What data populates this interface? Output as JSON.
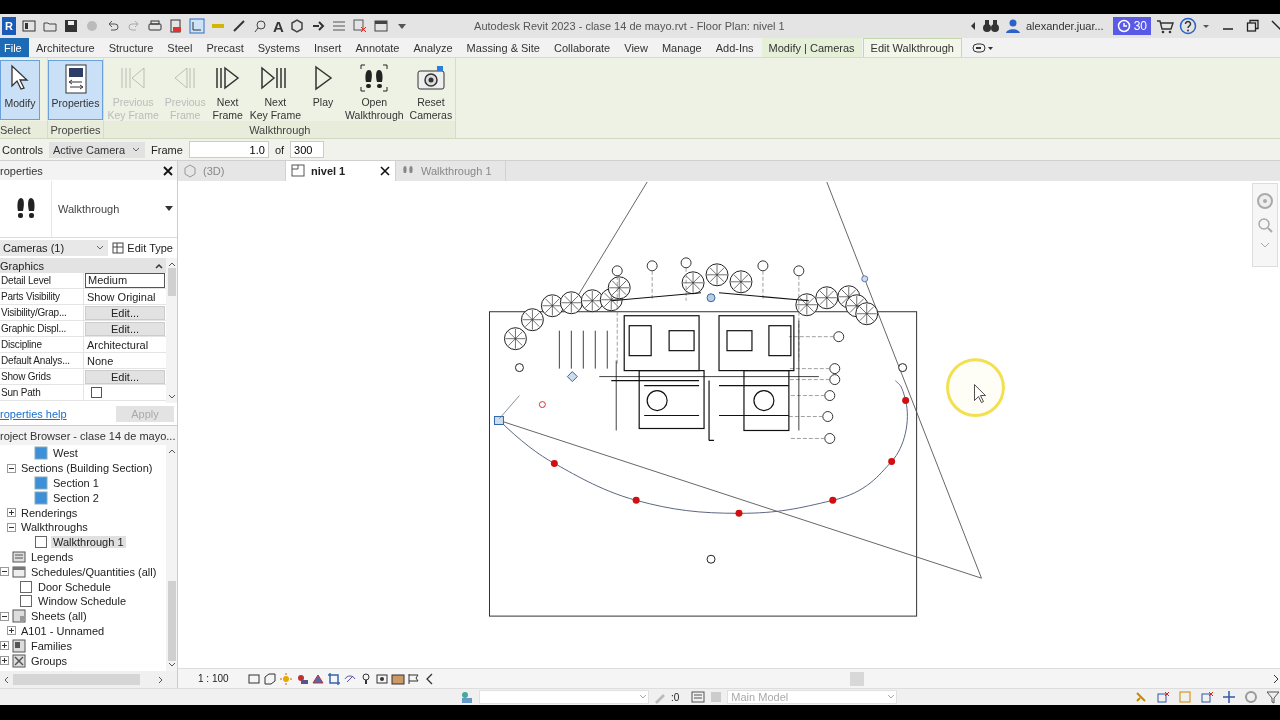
{
  "title_bar": {
    "logo": "R",
    "text_tool": "A",
    "title": "Autodesk Revit 2023 - clase 14 de mayo.rvt - Floor Plan: nivel 1",
    "user": "alexander.juar...",
    "trial_days": "30"
  },
  "menu_tabs": [
    {
      "label": "File",
      "kind": "file",
      "selected": false
    },
    {
      "label": "Architecture",
      "kind": "tab",
      "selected": false
    },
    {
      "label": "Structure",
      "kind": "tab",
      "selected": false
    },
    {
      "label": "Steel",
      "kind": "tab",
      "selected": false
    },
    {
      "label": "Precast",
      "kind": "tab",
      "selected": false
    },
    {
      "label": "Systems",
      "kind": "tab",
      "selected": false
    },
    {
      "label": "Insert",
      "kind": "tab",
      "selected": false
    },
    {
      "label": "Annotate",
      "kind": "tab",
      "selected": false
    },
    {
      "label": "Analyze",
      "kind": "tab",
      "selected": false
    },
    {
      "label": "Massing & Site",
      "kind": "tab",
      "selected": false
    },
    {
      "label": "Collaborate",
      "kind": "tab",
      "selected": false
    },
    {
      "label": "View",
      "kind": "tab",
      "selected": false
    },
    {
      "label": "Manage",
      "kind": "tab",
      "selected": false
    },
    {
      "label": "Add-Ins",
      "kind": "tab",
      "selected": false
    },
    {
      "label": "Modify | Cameras",
      "kind": "context",
      "selected": false
    },
    {
      "label": "Edit Walkthrough",
      "kind": "context",
      "selected": true
    }
  ],
  "ribbon": {
    "panels": [
      {
        "label": "Select",
        "buttons": [
          {
            "label": "Modify",
            "kind": "modify",
            "selected": true,
            "disabled": false
          }
        ]
      },
      {
        "label": "Properties",
        "buttons": [
          {
            "label": "Properties",
            "kind": "properties",
            "selected": true,
            "disabled": false
          }
        ]
      },
      {
        "label": "Walkthrough",
        "buttons": [
          {
            "label": "Previous\nKey Frame",
            "kind": "prev-key",
            "selected": false,
            "disabled": true
          },
          {
            "label": "Previous\nFrame",
            "kind": "prev-frame",
            "selected": false,
            "disabled": true
          },
          {
            "label": "Next\nFrame",
            "kind": "next-frame",
            "selected": false,
            "disabled": false
          },
          {
            "label": "Next\nKey Frame",
            "kind": "next-key",
            "selected": false,
            "disabled": false
          },
          {
            "label": "Play",
            "kind": "play",
            "selected": false,
            "disabled": false
          },
          {
            "label": "Open\nWalkthrough",
            "kind": "open",
            "selected": false,
            "disabled": false
          },
          {
            "label": "Reset\nCameras",
            "kind": "reset",
            "selected": false,
            "disabled": false
          }
        ]
      }
    ]
  },
  "options_bar": {
    "label": "Controls",
    "control": "Active Camera",
    "frame_label": "Frame",
    "frame_value": "1.0",
    "of_label": "of",
    "total": "300"
  },
  "properties": {
    "title": "roperties",
    "type": "Walkthrough",
    "selection": "Cameras (1)",
    "edit_type": "Edit Type",
    "group": "Graphics",
    "rows": [
      {
        "name": "Detail Level",
        "value": "Medium",
        "kind": "select"
      },
      {
        "name": "Parts Visibility",
        "value": "Show Original",
        "kind": "text"
      },
      {
        "name": "Visibility/Grap...",
        "value": "Edit...",
        "kind": "button"
      },
      {
        "name": "Graphic Displ...",
        "value": "Edit...",
        "kind": "button"
      },
      {
        "name": "Discipline",
        "value": "Architectural",
        "kind": "text"
      },
      {
        "name": "Default Analys...",
        "value": "None",
        "kind": "text"
      },
      {
        "name": "Show Grids",
        "value": "Edit...",
        "kind": "button"
      },
      {
        "name": "Sun Path",
        "kind": "checkbox",
        "checked": false
      }
    ],
    "help": "roperties help",
    "apply": {
      "label": "Apply",
      "disabled": true
    }
  },
  "project_browser": {
    "title": "roject Browser - clase 14 de mayo...",
    "items": [
      {
        "children": [
          {
            "children": [
              {
                "label": "West",
                "kind": "view",
                "selected": false
              }
            ]
          },
          {
            "label": "Sections (Building Section)",
            "kind": "none",
            "expanded": true,
            "selected": false,
            "children": [
              {
                "label": "Section 1",
                "kind": "view",
                "selected": false
              },
              {
                "label": "Section 2",
                "kind": "view",
                "selected": false
              }
            ]
          },
          {
            "label": "Renderings",
            "kind": "none",
            "expanded": false,
            "selected": false
          },
          {
            "label": "Walkthroughs",
            "kind": "none",
            "expanded": true,
            "selected": false,
            "children": [
              {
                "label": "Walkthrough 1",
                "kind": "blank",
                "selected": true
              }
            ]
          }
        ]
      },
      {
        "label": "Legends",
        "kind": "legend",
        "selected": false
      },
      {
        "label": "Schedules/Quantities (all)",
        "kind": "schedule",
        "expanded": true,
        "selected": false,
        "children": [
          {
            "label": "Door Schedule",
            "kind": "blank",
            "selected": false
          },
          {
            "label": "Window Schedule",
            "kind": "blank",
            "selected": false
          }
        ]
      },
      {
        "label": "Sheets (all)",
        "kind": "sheet",
        "expanded": true,
        "selected": false,
        "children": [
          {
            "label": "A101 - Unnamed",
            "kind": "none",
            "expanded": false,
            "selected": false
          }
        ]
      },
      {
        "label": "Families",
        "kind": "family",
        "expanded": false,
        "selected": false
      },
      {
        "label": "Groups",
        "kind": "group",
        "expanded": false,
        "selected": false
      }
    ]
  },
  "view_tabs": [
    {
      "label": "(3D)",
      "kind": "model",
      "selected": false
    },
    {
      "label": "nivel 1",
      "kind": "plan",
      "selected": true
    },
    {
      "label": "Walkthrough 1",
      "kind": "walkthrough",
      "selected": false
    }
  ],
  "view_control_bar": {
    "scale": "1 : 100"
  },
  "status_bar": {
    "counter": ":0",
    "model": "Main Model"
  }
}
